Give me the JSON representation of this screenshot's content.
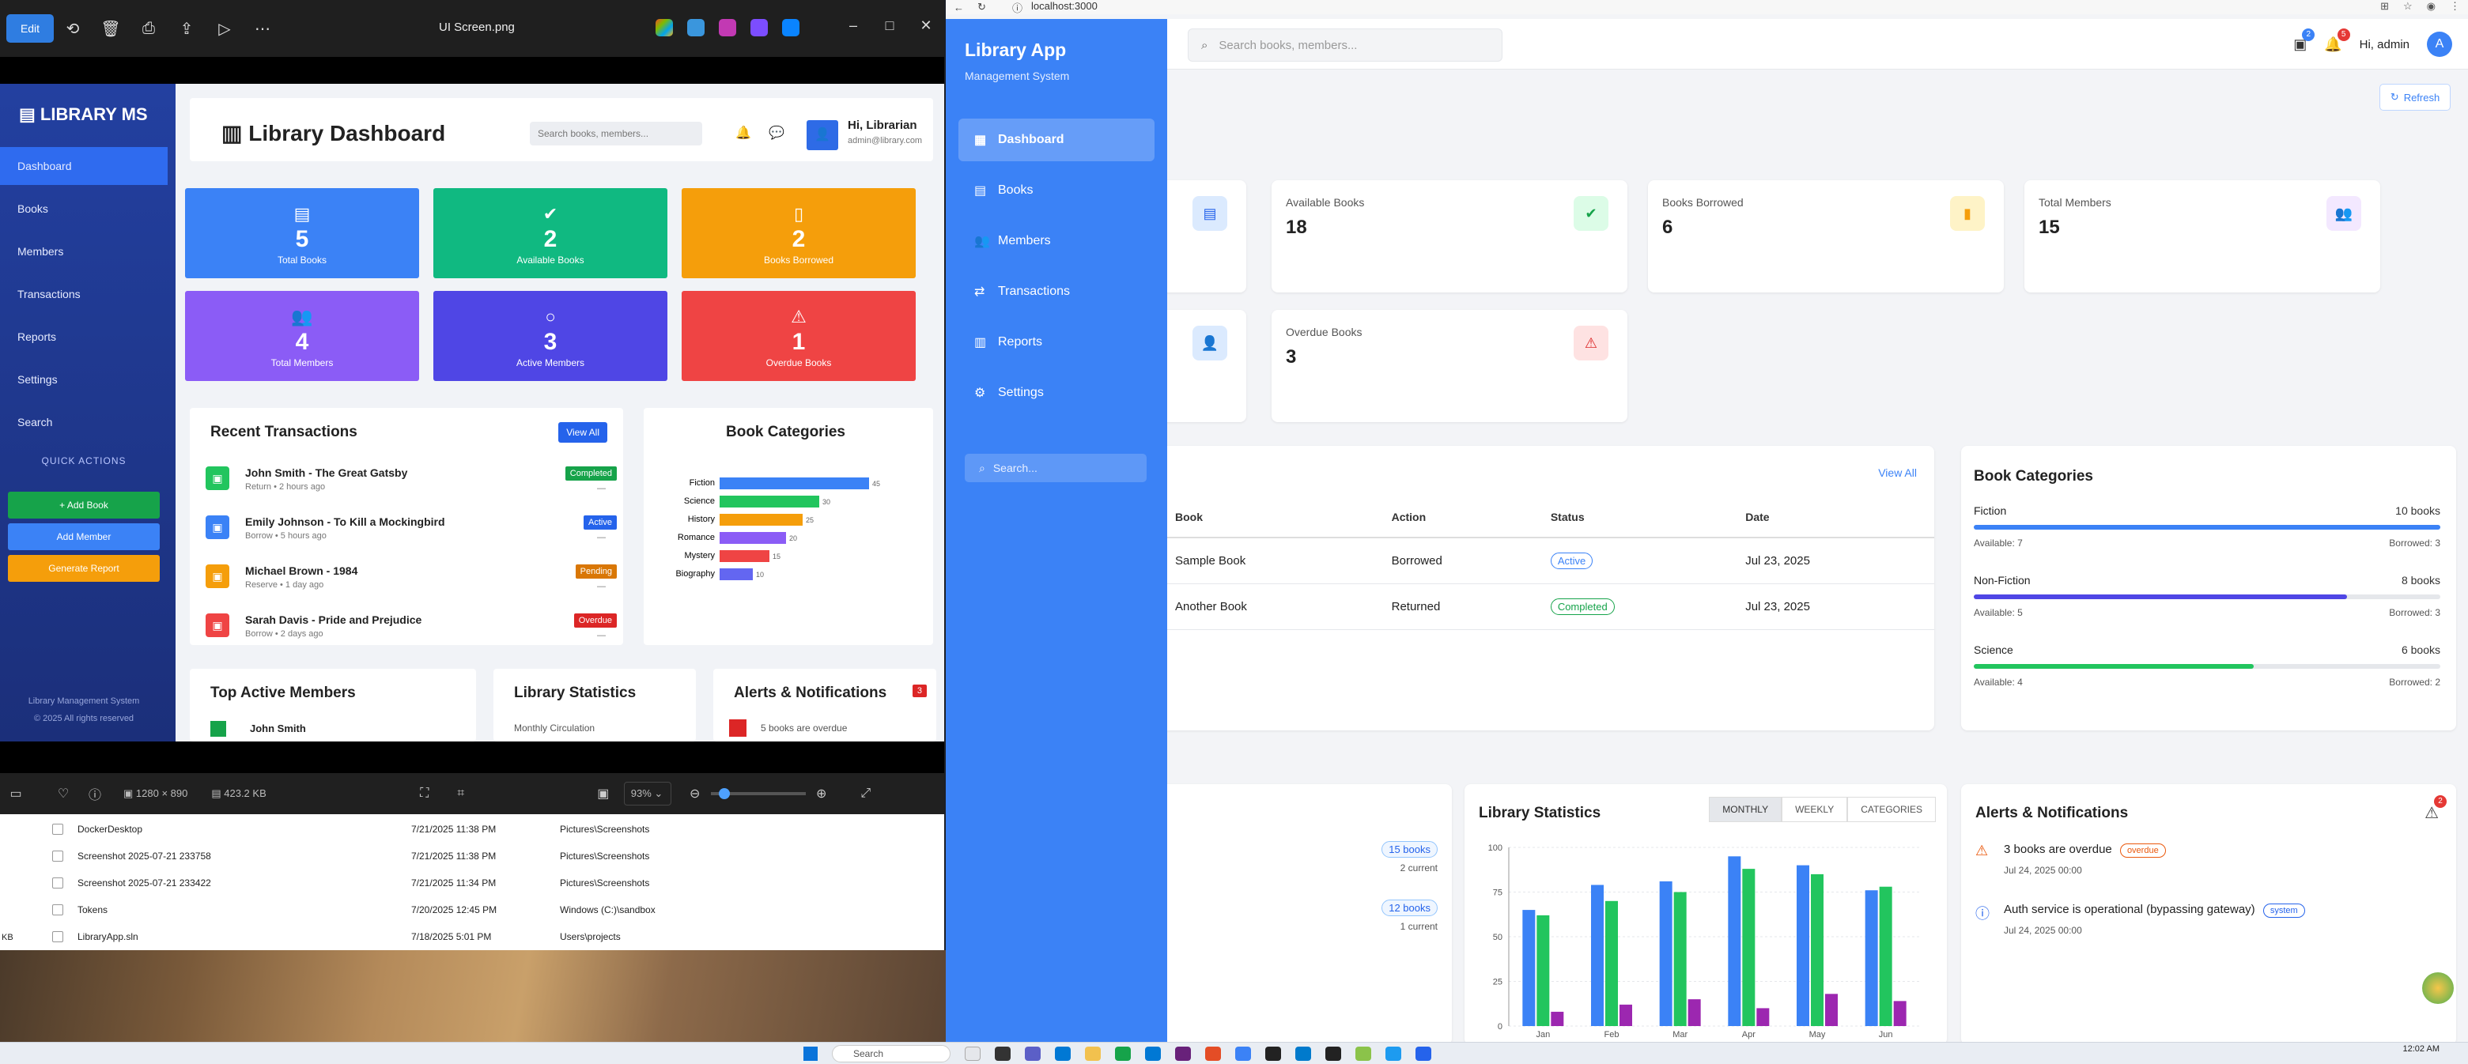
{
  "viewer": {
    "edit_label": "Edit",
    "title": "UI Screen.png",
    "dims": "1280 × 890",
    "size": "423.2 KB",
    "zoom": "93%"
  },
  "lms": {
    "brand": "LIBRARY MS",
    "nav": [
      "Dashboard",
      "Books",
      "Members",
      "Transactions",
      "Reports",
      "Settings",
      "Search"
    ],
    "quick_actions_title": "QUICK ACTIONS",
    "quick_actions": [
      "+ Add Book",
      "Add Member",
      "Generate Report"
    ],
    "footer1": "Library Management System",
    "footer2": "© 2025 All rights reserved",
    "title": "Library Dashboard",
    "search_placeholder": "Search books, members...",
    "user_name": "Hi, Librarian",
    "user_email": "admin@library.com",
    "cards": [
      {
        "value": "5",
        "label": "Total Books",
        "color": "#3b82f6"
      },
      {
        "value": "2",
        "label": "Available Books",
        "color": "#10b981"
      },
      {
        "value": "2",
        "label": "Books Borrowed",
        "color": "#f59e0b"
      },
      {
        "value": "4",
        "label": "Total Members",
        "color": "#8b5cf6"
      },
      {
        "value": "3",
        "label": "Active Members",
        "color": "#4f46e5"
      },
      {
        "value": "1",
        "label": "Overdue Books",
        "color": "#ef4444"
      }
    ],
    "recent_title": "Recent Transactions",
    "view_all": "View All",
    "transactions": [
      {
        "title": "John Smith - The Great Gatsby",
        "meta": "Return • 2 hours ago",
        "status": "Completed",
        "status_color": "#16a34a",
        "icon_color": "#22c55e"
      },
      {
        "title": "Emily Johnson - To Kill a Mockingbird",
        "meta": "Borrow • 5 hours ago",
        "status": "Active",
        "status_color": "#2563eb",
        "icon_color": "#3b82f6"
      },
      {
        "title": "Michael Brown - 1984",
        "meta": "Reserve • 1 day ago",
        "status": "Pending",
        "status_color": "#d97706",
        "icon_color": "#f59e0b"
      },
      {
        "title": "Sarah Davis - Pride and Prejudice",
        "meta": "Borrow • 2 days ago",
        "status": "Overdue",
        "status_color": "#dc2626",
        "icon_color": "#ef4444"
      }
    ],
    "book_categories_title": "Book Categories",
    "top_members_title": "Top Active Members",
    "top_member_first": "John Smith",
    "library_stats_title": "Library Statistics",
    "monthly_circulation": "Monthly Circulation",
    "alerts_title": "Alerts & Notifications",
    "alerts_count": "3",
    "alert_first": "5 books are overdue"
  },
  "lms_chart": {
    "chart_data": {
      "type": "bar",
      "categories": [
        "Fiction",
        "Science",
        "History",
        "Romance",
        "Mystery",
        "Biography"
      ],
      "values": [
        45,
        30,
        25,
        20,
        15,
        10
      ],
      "colors": [
        "#3b82f6",
        "#22c55e",
        "#f59e0b",
        "#8b5cf6",
        "#ef4444",
        "#6366f1"
      ]
    }
  },
  "explorer": {
    "rows": [
      {
        "name": "DockerDesktop",
        "date": "7/21/2025 11:38 PM",
        "path": "Pictures\\Screenshots"
      },
      {
        "name": "Screenshot 2025-07-21 233758",
        "date": "7/21/2025 11:38 PM",
        "path": "Pictures\\Screenshots"
      },
      {
        "name": "Screenshot 2025-07-21 233422",
        "date": "7/21/2025 11:34 PM",
        "path": "Pictures\\Screenshots"
      },
      {
        "name": "Tokens",
        "date": "7/20/2025 12:45 PM",
        "path": "Windows (C:)\\sandbox"
      },
      {
        "name": "LibraryApp.sln",
        "date": "7/18/2025 5:01 PM",
        "path": "Users\\projects"
      }
    ],
    "kb": "KB"
  },
  "browser": {
    "url": "localhost:3000"
  },
  "app": {
    "brand": "Library App",
    "subtitle": "Management System",
    "nav": [
      "Dashboard",
      "Books",
      "Members",
      "Transactions",
      "Reports",
      "Settings"
    ],
    "side_search": "Search...",
    "search_placeholder": "Search books, members...",
    "msg_badge": "2",
    "bell_badge": "5",
    "greeting": "Hi, admin",
    "avatar": "A",
    "refresh": "Refresh",
    "stats": [
      {
        "label": "Available Books",
        "value": "18",
        "icon_bg": "#dcfce7",
        "icon_fg": "#16a34a"
      },
      {
        "label": "Books Borrowed",
        "value": "6",
        "icon_bg": "#fef3c7",
        "icon_fg": "#f59e0b"
      },
      {
        "label": "Total Members",
        "value": "15",
        "icon_bg": "#f3e8ff",
        "icon_fg": "#a855f7"
      },
      {
        "label": "Overdue Books",
        "value": "3",
        "icon_bg": "#fee2e2",
        "icon_fg": "#dc2626"
      }
    ],
    "view_all": "View All",
    "table_headers": [
      "Book",
      "Action",
      "Status",
      "Date"
    ],
    "table_rows": [
      {
        "book": "Sample Book",
        "action": "Borrowed",
        "status": "Active",
        "date": "Jul 23, 2025"
      },
      {
        "book": "Another Book",
        "action": "Returned",
        "status": "Completed",
        "date": "Jul 23, 2025"
      }
    ],
    "categories_title": "Book Categories",
    "categories": [
      {
        "name": "Fiction",
        "count": "10 books",
        "available": "Available: 7",
        "borrowed": "Borrowed: 3",
        "fill": 1.0,
        "color": "#3b82f6"
      },
      {
        "name": "Non-Fiction",
        "count": "8 books",
        "available": "Available: 5",
        "borrowed": "Borrowed: 3",
        "fill": 0.8,
        "color": "#4f46e5"
      },
      {
        "name": "Science",
        "count": "6 books",
        "available": "Available: 4",
        "borrowed": "Borrowed: 2",
        "fill": 0.6,
        "color": "#22c55e"
      }
    ],
    "members_chips": [
      {
        "chip": "15 books",
        "sub": "2 current"
      },
      {
        "chip": "12 books",
        "sub": "1 current"
      }
    ],
    "stats_title": "Library Statistics",
    "tabs": [
      "MONTHLY",
      "WEEKLY",
      "CATEGORIES"
    ],
    "alerts_title": "Alerts & Notifications",
    "alerts_badge": "2",
    "alerts": [
      {
        "text": "3 books are overdue",
        "tag": "overdue",
        "time": "Jul 24, 2025 00:00",
        "color": "#ea580c"
      },
      {
        "text": "Auth service is operational (bypassing gateway)",
        "tag": "system",
        "time": "Jul 24, 2025 00:00",
        "color": "#2563eb"
      }
    ]
  },
  "chart_data": {
    "type": "bar",
    "categories": [
      "Jan",
      "Feb",
      "Mar",
      "Apr",
      "May",
      "Jun"
    ],
    "series": [
      {
        "values": [
          65,
          79,
          81,
          95,
          90,
          76
        ],
        "color": "#3b82f6"
      },
      {
        "values": [
          62,
          70,
          75,
          88,
          85,
          78
        ],
        "color": "#22c55e"
      },
      {
        "values": [
          8,
          12,
          15,
          10,
          18,
          14
        ],
        "color": "#9c27b0"
      }
    ],
    "ylim": [
      0,
      100
    ],
    "yticks": [
      0,
      25,
      50,
      75,
      100
    ],
    "grid": true
  },
  "taskbar": {
    "search": "Search",
    "time": "12:02 AM"
  }
}
